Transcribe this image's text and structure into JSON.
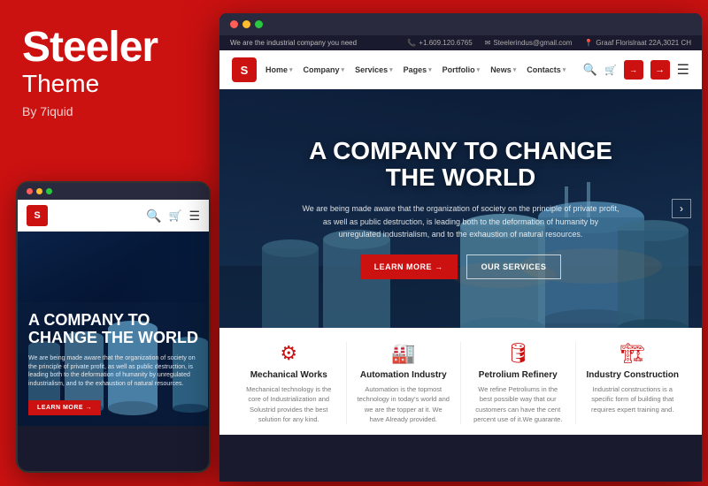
{
  "brand": {
    "title": "Steeler",
    "subtitle": "Theme",
    "by": "By 7iquid"
  },
  "browser": {
    "dots": [
      "red",
      "yellow",
      "green"
    ]
  },
  "topbar": {
    "tagline": "We are the industrial company you need",
    "phone": "+1.609.120.6765",
    "email": "Steelerindus@gmail.com",
    "address": "Graaf Florislraat 22A,3021 CH"
  },
  "navbar": {
    "logo": "S",
    "links": [
      {
        "label": "Home",
        "has_dropdown": true
      },
      {
        "label": "Company",
        "has_dropdown": true
      },
      {
        "label": "Services",
        "has_dropdown": true
      },
      {
        "label": "Pages",
        "has_dropdown": true
      },
      {
        "label": "Portfolio",
        "has_dropdown": true
      },
      {
        "label": "News",
        "has_dropdown": true
      },
      {
        "label": "Contacts",
        "has_dropdown": true
      }
    ]
  },
  "hero": {
    "title_line1": "A COMPANY TO CHANGE",
    "title_line2": "THE WORLD",
    "description": "We are being made aware that the organization of society on the principle of private profit, as well as public destruction, is leading both to the deformation of humanity by unregulated industrialism, and to the exhaustion of natural resources.",
    "btn_learn": "LEARN MORE →",
    "btn_services": "OUR SERVICES"
  },
  "mobile_hero": {
    "title": "A COMPANY TO CHANGE THE WORLD",
    "description": "We are being made aware that the organization of society on the principle of private profit, as well as public destruction, is leading both to the deformation of humanity by unregulated industrialism, and to the exhaustion of natural resources.",
    "btn": "LEARN MORE →"
  },
  "services": [
    {
      "icon": "⚙",
      "title": "Mechanical Works",
      "description": "Mechanical technology is the core of Industrialization and Solustrid provides the best solution for any kind."
    },
    {
      "icon": "🏭",
      "title": "Automation Industry",
      "description": "Automation is the topmost technology in today's world and we are the topper at it. We have Already provided."
    },
    {
      "icon": "🛢",
      "title": "Petrolium Refinery",
      "description": "We refine Petroliums in the best possible way that our customers can have the cent percent use of it.We guarante."
    },
    {
      "icon": "🏗",
      "title": "Industry Construction",
      "description": "Industrial constructions is a specific form of building that requires expert training and."
    }
  ],
  "colors": {
    "brand_red": "#cc1111",
    "dark_bg": "#1a1a2e"
  }
}
